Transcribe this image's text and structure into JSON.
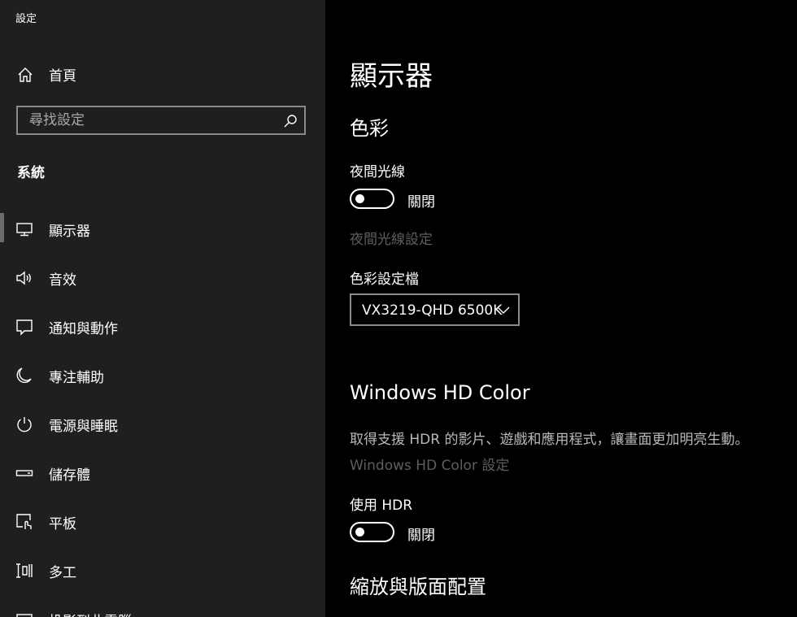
{
  "app": {
    "title": "設定"
  },
  "sidebar": {
    "home_label": "首頁",
    "search_placeholder": "尋找設定",
    "section_title": "系統",
    "items": [
      {
        "label": "顯示器",
        "icon": "monitor-icon",
        "selected": true
      },
      {
        "label": "音效",
        "icon": "speaker-icon"
      },
      {
        "label": "通知與動作",
        "icon": "message-icon"
      },
      {
        "label": "專注輔助",
        "icon": "moon-icon"
      },
      {
        "label": "電源與睡眠",
        "icon": "power-icon"
      },
      {
        "label": "儲存體",
        "icon": "storage-icon"
      },
      {
        "label": "平板",
        "icon": "tablet-icon"
      },
      {
        "label": "多工",
        "icon": "multitask-icon"
      },
      {
        "label": "投影到此電腦",
        "icon": "project-icon"
      }
    ]
  },
  "main": {
    "page_title": "顯示器",
    "color_heading": "色彩",
    "night_light_label": "夜間光線",
    "night_light_state": "關閉",
    "night_light_settings_link": "夜間光線設定",
    "color_profile_label": "色彩設定檔",
    "color_profile_value": "VX3219-QHD 6500K",
    "hd_color_heading": "Windows HD Color",
    "hd_color_desc": "取得支援 HDR 的影片、遊戲和應用程式，讓畫面更加明亮生動。",
    "hd_color_settings_link": "Windows HD Color 設定",
    "use_hdr_label": "使用 HDR",
    "use_hdr_state": "關閉",
    "scale_heading": "縮放與版面配置"
  },
  "colors": {
    "sidebar_bg": "#1f1f1f",
    "main_bg": "#000000",
    "dim_text": "#5e5e5e"
  }
}
